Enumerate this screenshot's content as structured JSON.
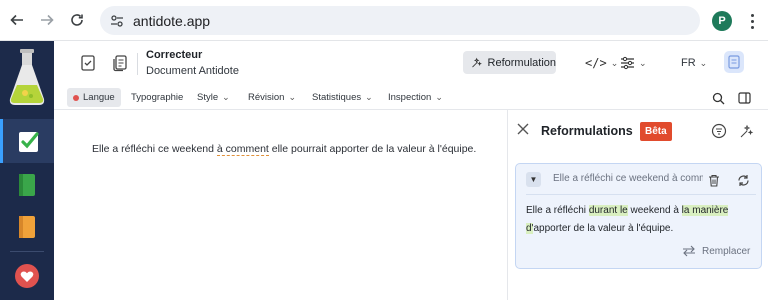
{
  "browser": {
    "url": "antidote.app",
    "profile_initial": "P"
  },
  "header": {
    "title": "Correcteur",
    "subtitle": "Document Antidote",
    "reformulation_button": "Reformulation",
    "language": "FR"
  },
  "menu": {
    "items": [
      "Langue",
      "Typographie",
      "Style",
      "Révision",
      "Statistiques",
      "Inspection"
    ]
  },
  "document": {
    "text_before": "Elle a réfléchi ce weekend ",
    "text_flagged": "à comment",
    "text_after": " elle pourrait apporter de la valeur à l'équipe."
  },
  "panel": {
    "title": "Reformulations",
    "badge": "Bêta",
    "card": {
      "preview": "Elle a réfléchi ce weekend à comment elle pourrait apporter de la valeur à l'équipe.",
      "seg1": "Elle a réfléchi ",
      "hl1": "durant le",
      "seg2": " weekend à ",
      "hl2": "la manière",
      "hl3": "d'",
      "seg3": "apporter de la valeur à l'équipe.",
      "replace_label": "Remplacer"
    }
  },
  "colors": {
    "sidebar_bg": "#1c2a4a",
    "beta_badge": "#e14b2d",
    "highlight": "#d9efc0",
    "flag_underline": "#e1913a",
    "card_bg": "#eef3fc"
  }
}
